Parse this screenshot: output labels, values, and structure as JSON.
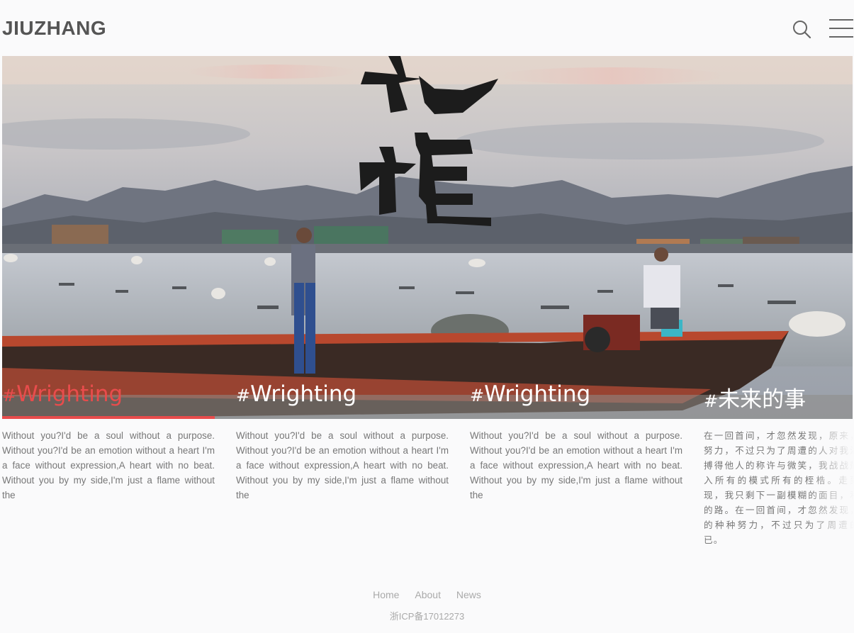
{
  "header": {
    "logo": "JIUZHANG",
    "search_icon": "search-icon",
    "menu_icon": "hamburger-menu-icon"
  },
  "hero": {
    "image": "fishing-boat-sea-photo",
    "calligraphy": "九章"
  },
  "tabs": [
    {
      "hash": "#",
      "label": "Wrighting",
      "active": true
    },
    {
      "hash": "#",
      "label": "Wrighting",
      "active": false
    },
    {
      "hash": "#",
      "label": "Wrighting",
      "active": false
    },
    {
      "hash": "#",
      "label": "未来的事",
      "active": false
    }
  ],
  "descriptions": [
    "Without you?I'd be a soul without a purpose. Without you?I'd be an emotion without a heart I'm a face without expression,A heart with no beat. Without you by my side,I'm just a flame without the",
    "Without you?I'd be a soul without a purpose. Without you?I'd be an emotion without a heart I'm a face without expression,A heart with no beat. Without you by my side,I'm just a flame without the",
    "Without you?I'd be a soul without a purpose. Without you?I'd be an emotion without a heart I'm a face without expression,A heart with no beat. Without you by my side,I'm just a flame without the",
    "在一回首间，才忽然发现，原来，努力，不过只为了周遭的人对我满搏得他人的称许与微笑，我战战兢入所有的模式所有的桎梏。走到现，我只剩下一副模糊的面目，和的路。在一回首间，才忽然发现，的种种努力，不过只为了周遭的已。"
  ],
  "footer": {
    "nav": [
      "Home",
      "About",
      "News"
    ],
    "icp": "浙ICP备17012273"
  },
  "colors": {
    "accent": "#e84c4c",
    "text": "#777777",
    "background": "#fafafb"
  }
}
